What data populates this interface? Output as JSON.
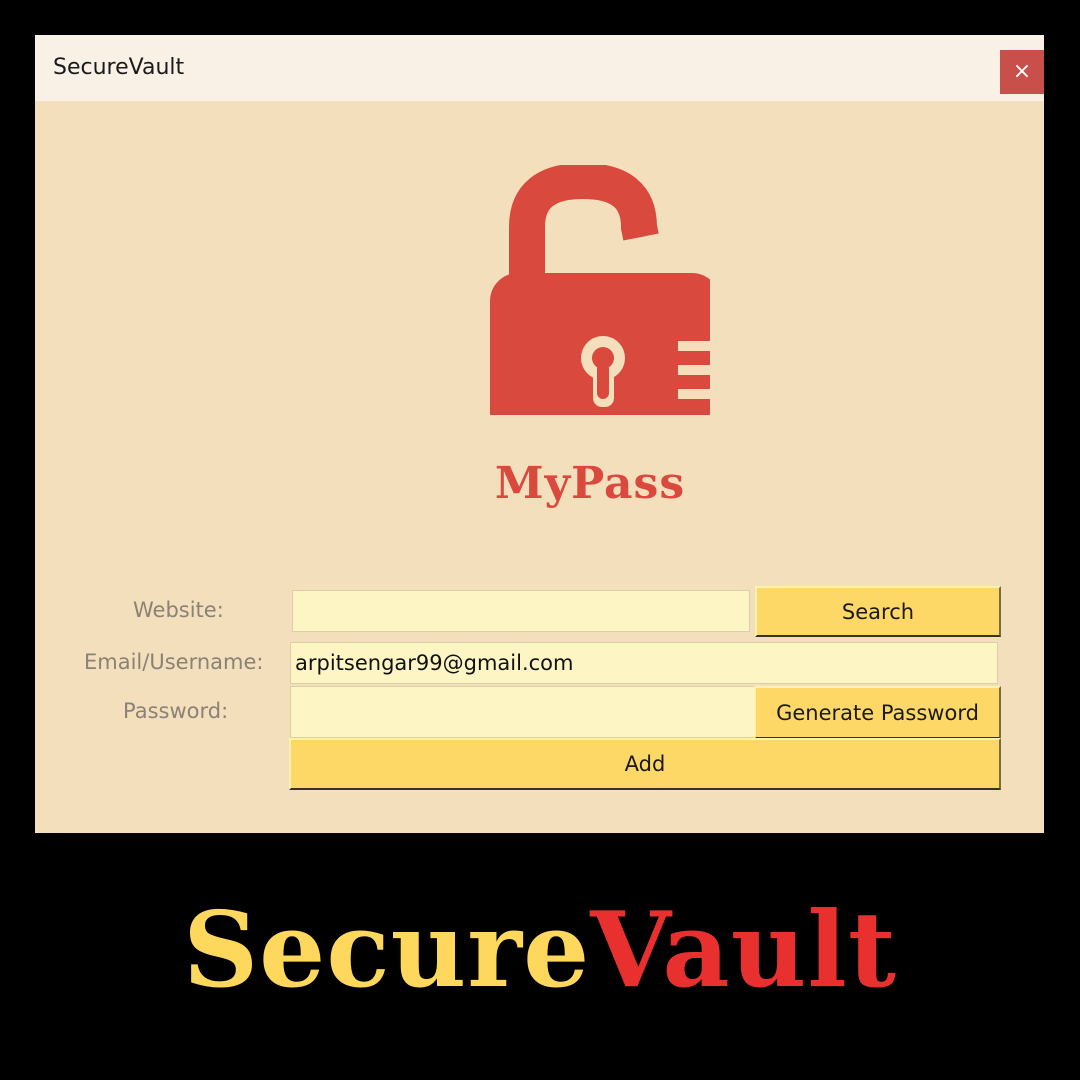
{
  "window": {
    "title": "SecureVault",
    "close_label": "×"
  },
  "logo": {
    "icon": "open-padlock-icon",
    "text": "MyPass",
    "color": "#d9493e"
  },
  "form": {
    "website_label": "Website:",
    "website_value": "",
    "email_label": "Email/Username:",
    "email_value": "arpitsengar99@gmail.com",
    "password_label": "Password:",
    "password_value": "",
    "search_label": "Search",
    "generate_label": "Generate Password",
    "add_label": "Add"
  },
  "banner": {
    "part1": "Secure",
    "part2": "Vault"
  },
  "colors": {
    "window_bg": "#f3dfbc",
    "input_bg": "#fdf6c4",
    "button_bg": "#fed866",
    "close_bg": "#c94f4b"
  }
}
